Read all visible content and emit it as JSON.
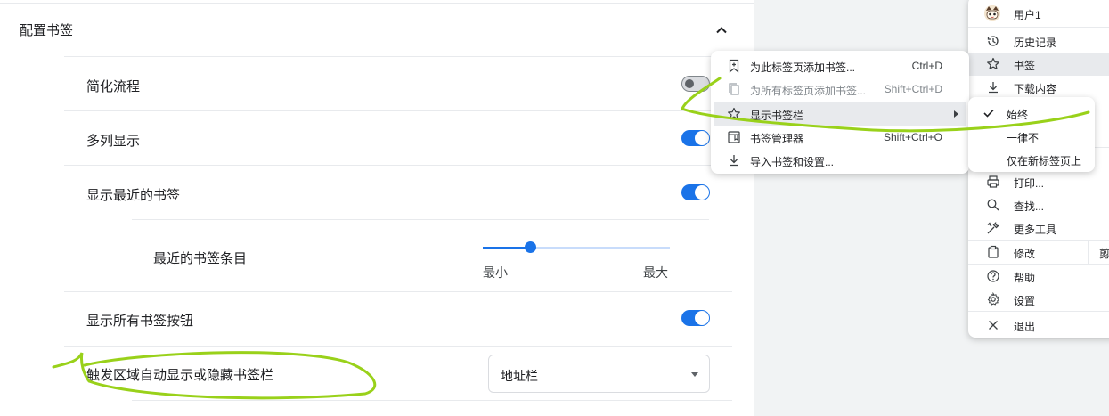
{
  "settings": {
    "section_title": "配置书签",
    "rows": {
      "simplify": {
        "label": "简化流程",
        "enabled": false
      },
      "multi_column": {
        "label": "多列显示",
        "enabled": true
      },
      "show_recent": {
        "label": "显示最近的书签",
        "enabled": true
      },
      "show_all_button": {
        "label": "显示所有书签按钮",
        "enabled": true
      },
      "auto_show": {
        "label": "触发区域自动显示或隐藏书签栏"
      }
    },
    "recent_count": {
      "label": "最近的书签条目",
      "min_label": "最小",
      "max_label": "最大",
      "value_fraction": 0.25
    },
    "trigger_select": {
      "value": "地址栏"
    }
  },
  "main_menu": {
    "user": "用户1",
    "items": {
      "history": "历史记录",
      "bookmarks": "书签",
      "downloads": "下载内容",
      "print": "打印...",
      "find": "查找...",
      "more_tools": "更多工具",
      "edit": "修改",
      "edit_cut": "剪",
      "help": "帮助",
      "settings": "设置",
      "exit": "退出"
    }
  },
  "bookmarks_menu": {
    "add_this_tab": {
      "label": "为此标签页添加书签...",
      "shortcut": "Ctrl+D"
    },
    "add_all_tabs": {
      "label": "为所有标签页添加书签...",
      "shortcut": "Shift+Ctrl+D"
    },
    "show_bookmarks_bar": {
      "label": "显示书签栏"
    },
    "bookmark_manager": {
      "label": "书签管理器",
      "shortcut": "Shift+Ctrl+O"
    },
    "import": {
      "label": "导入书签和设置..."
    }
  },
  "bookmarks_bar_menu": {
    "always": "始终",
    "never": "一律不",
    "new_tab_only": "仅在新标签页上",
    "checked": "always"
  },
  "colors": {
    "accent": "#1a73e8",
    "annotation": "#99d11a",
    "highlight": "#e8eaed"
  },
  "icons": {
    "collapse": "chevron-up-icon",
    "history": "history-icon",
    "bookmarks": "star-icon",
    "downloads": "download-icon",
    "print": "printer-icon",
    "find": "search-icon",
    "more_tools": "tools-icon",
    "edit": "clipboard-icon",
    "help": "help-icon",
    "settings": "gear-icon",
    "exit": "close-icon",
    "add_bookmark": "bookmark-add-icon",
    "add_all": "copy-icon",
    "bookmark_bar": "star-icon",
    "manager": "bookmark-manager-icon",
    "import": "import-icon",
    "check": "check-icon"
  }
}
